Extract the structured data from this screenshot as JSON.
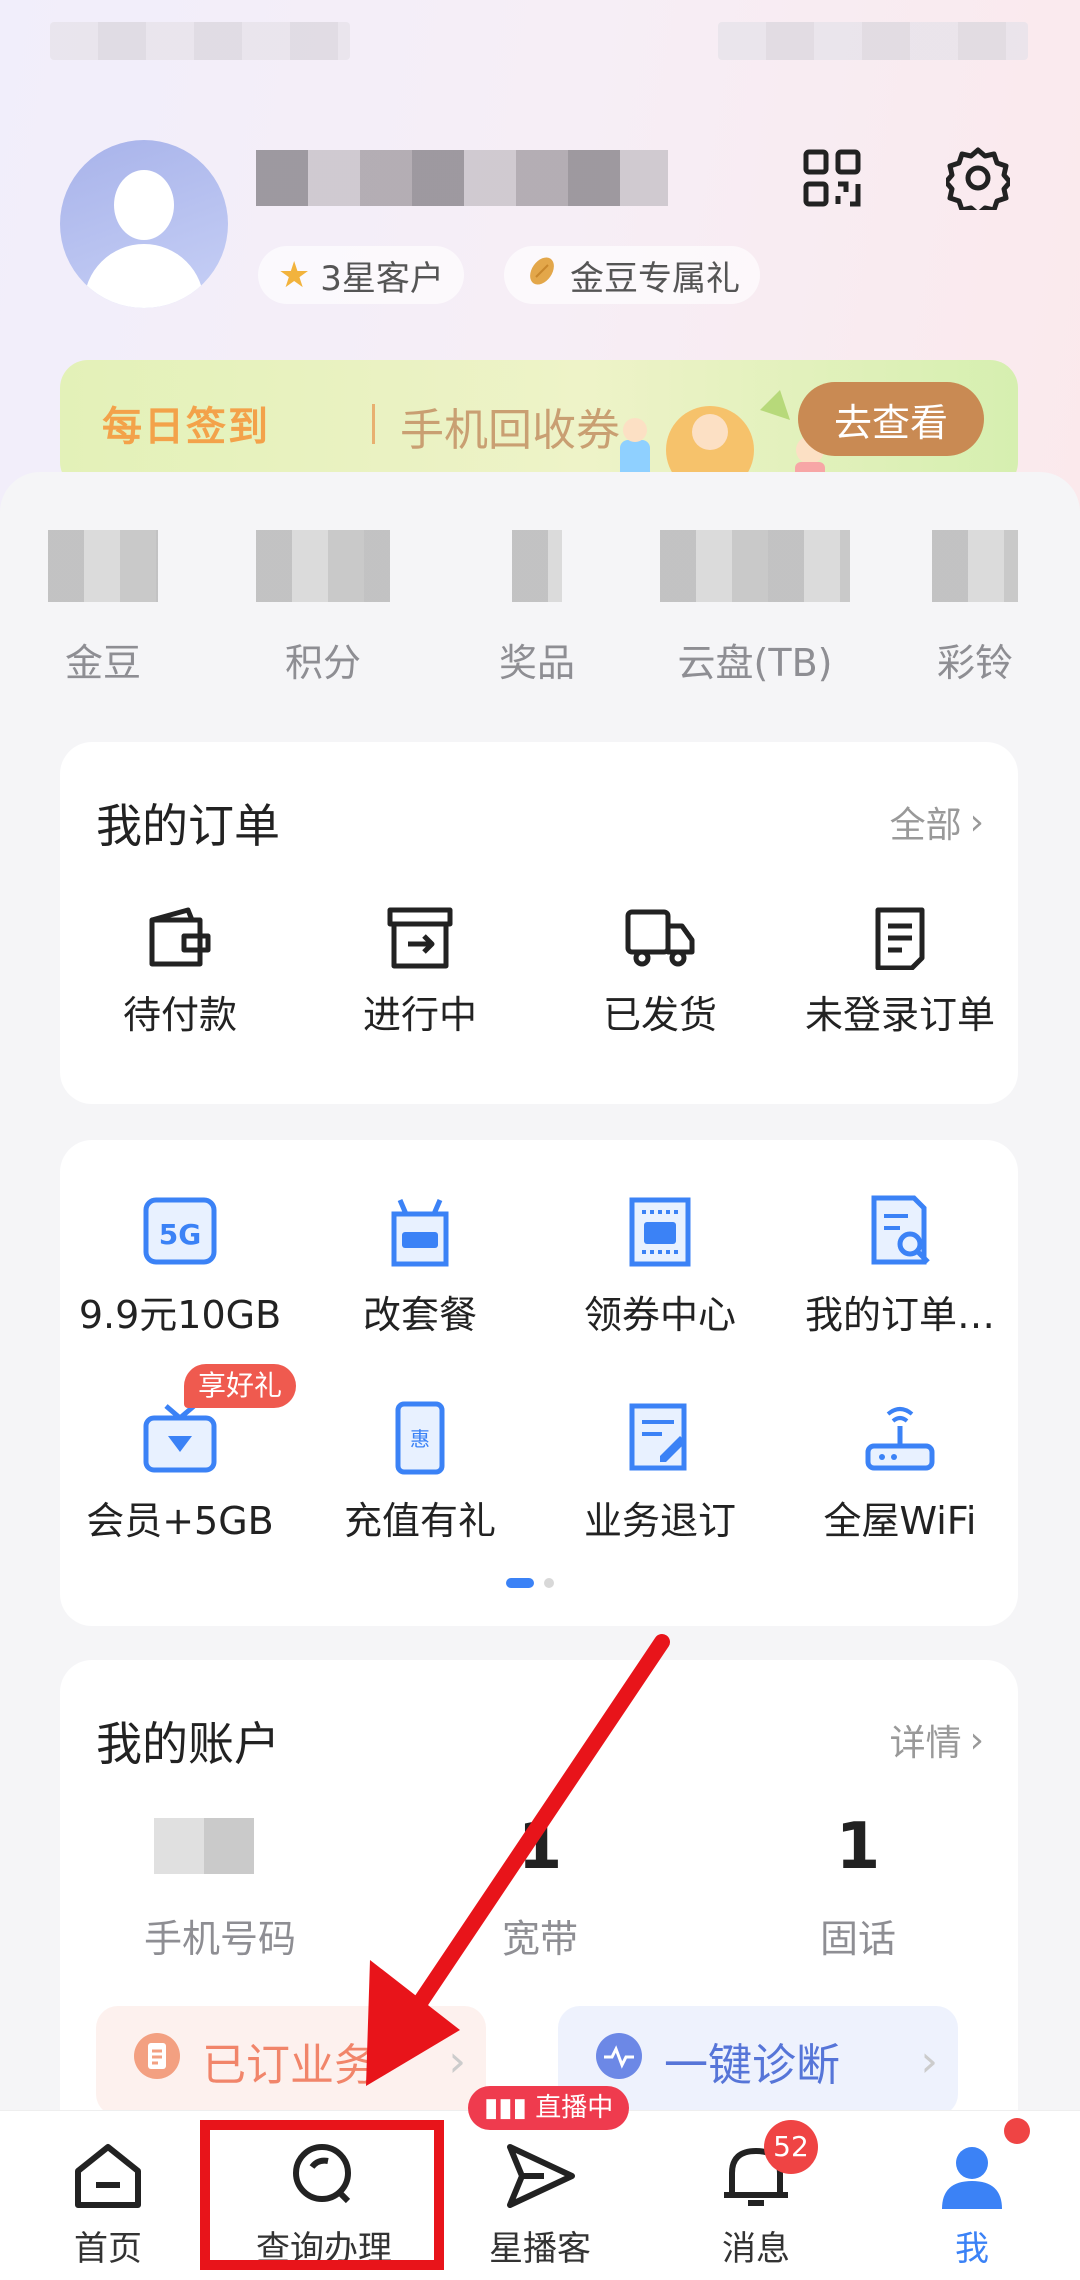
{
  "profile": {
    "star_level": "3星客户",
    "beans_gift": "金豆专属礼"
  },
  "banner": {
    "title": "每日签到",
    "subtitle": "手机回收券",
    "button": "去查看"
  },
  "stats": [
    {
      "label": "金豆"
    },
    {
      "label": "积分"
    },
    {
      "label": "奖品"
    },
    {
      "label": "云盘(TB)"
    },
    {
      "label": "彩铃"
    }
  ],
  "orders": {
    "title": "我的订单",
    "more": "全部",
    "items": [
      {
        "label": "待付款",
        "icon": "wallet-icon"
      },
      {
        "label": "进行中",
        "icon": "box-arrow-icon"
      },
      {
        "label": "已发货",
        "icon": "truck-icon"
      },
      {
        "label": "未登录订单",
        "icon": "document-icon"
      }
    ]
  },
  "services": {
    "gift_badge": "享好礼",
    "items": [
      {
        "label": "9.9元10GB",
        "icon": "5g-icon"
      },
      {
        "label": "改套餐",
        "icon": "package-icon"
      },
      {
        "label": "领券中心",
        "icon": "coupon-icon"
      },
      {
        "label": "我的订单…",
        "icon": "order-search-icon"
      },
      {
        "label": "会员+5GB",
        "icon": "tv-diamond-icon"
      },
      {
        "label": "充值有礼",
        "icon": "phone-card-icon"
      },
      {
        "label": "业务退订",
        "icon": "edit-doc-icon"
      },
      {
        "label": "全屋WiFi",
        "icon": "router-icon"
      }
    ]
  },
  "account": {
    "title": "我的账户",
    "more": "详情",
    "items": [
      {
        "label": "手机号码"
      },
      {
        "value": "1",
        "label": "宽带"
      },
      {
        "value": "1",
        "label": "固话"
      }
    ],
    "subscribed": "已订业务",
    "diagnose": "一键诊断"
  },
  "nav": {
    "home": "首页",
    "query": "查询办理",
    "live_badge": "直播中",
    "star": "星播客",
    "messages": "消息",
    "messages_count": "52",
    "me": "我"
  },
  "colors": {
    "accent_blue": "#3b82f6",
    "annotation_red": "#e8141a",
    "badge_red": "#ef4444"
  }
}
